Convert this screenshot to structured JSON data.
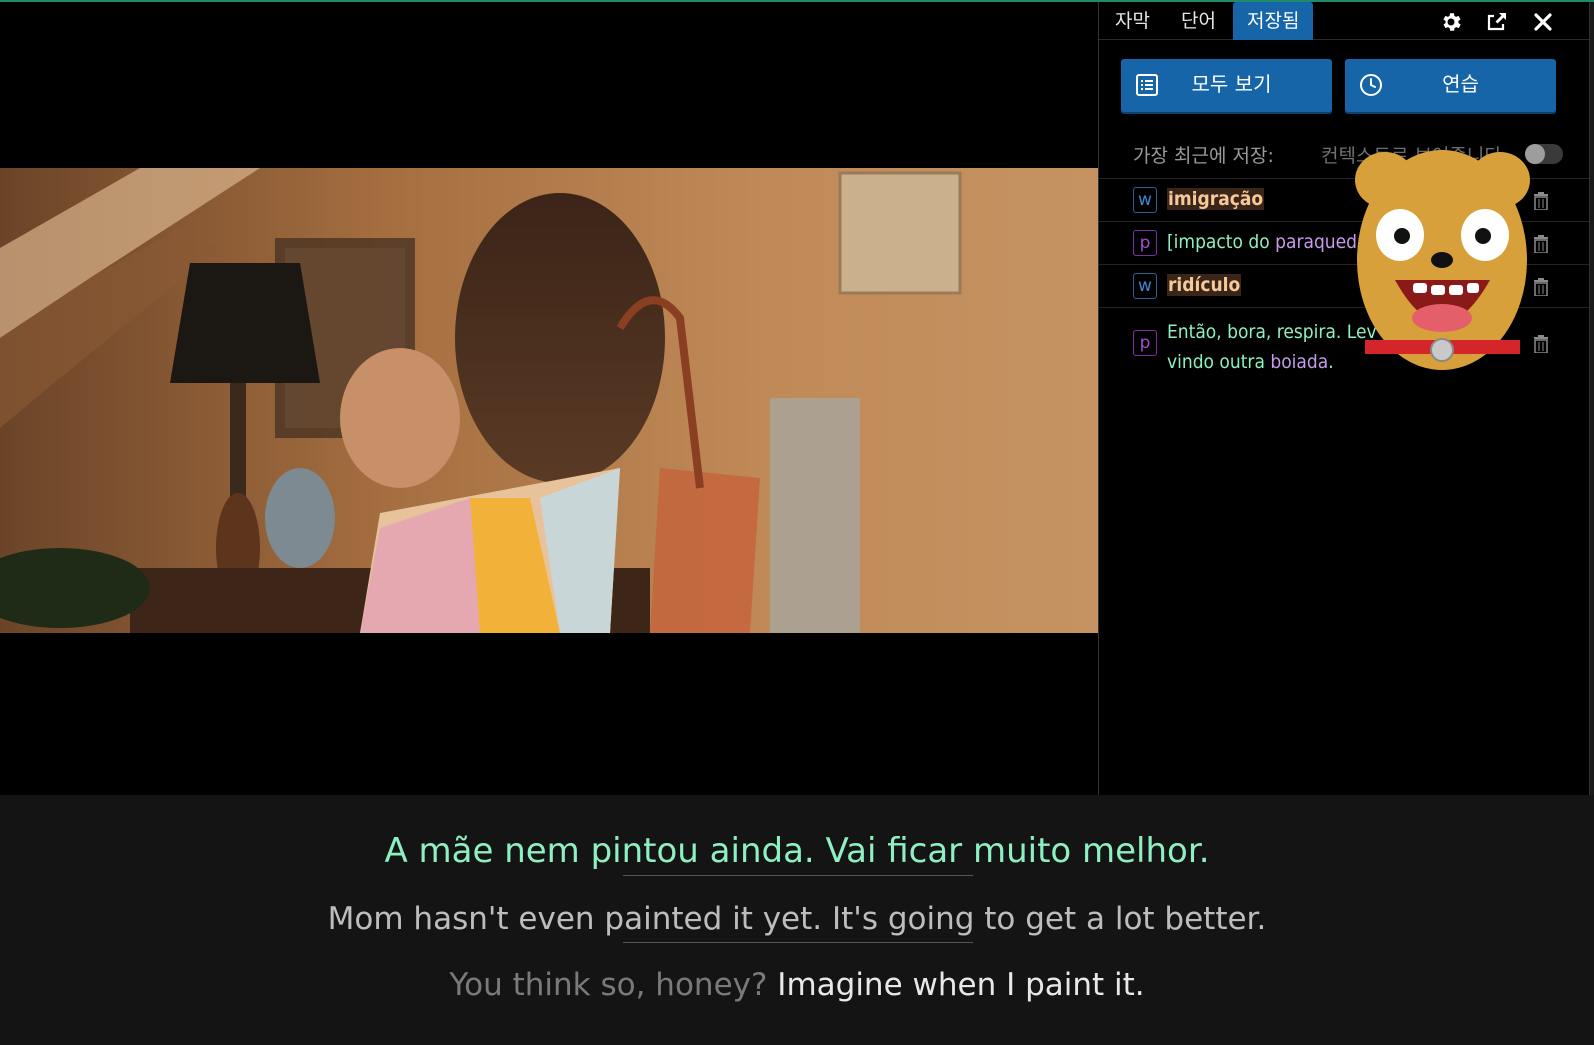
{
  "panel": {
    "tabs": [
      {
        "label": "자막",
        "active": false
      },
      {
        "label": "단어",
        "active": false
      },
      {
        "label": "저장됨",
        "active": true
      }
    ],
    "icons": [
      "gear-icon",
      "export-icon",
      "close-icon"
    ],
    "buttons": {
      "view_all": "모두 보기",
      "practice": "연습"
    },
    "recent_label": "가장 최근에 저장:",
    "context_label": "컨텍스트로 보여줍니다",
    "context_toggle_on": false,
    "saved_items": [
      {
        "type": "w",
        "text": "imigração"
      },
      {
        "type": "p",
        "text_parts": [
          "[impacto do ",
          "paraquedas"
        ]
      },
      {
        "type": "w",
        "text": "ridículo"
      },
      {
        "type": "p",
        "line1": "Então, bora, respira. Lev",
        "line2_parts": [
          "vindo outra ",
          "boiada",
          "."
        ]
      }
    ]
  },
  "subtitles": {
    "original": "A mãe nem pintou ainda. Vai ficar muito melhor.",
    "translation": "Mom hasn't even painted it yet. It's going to get a lot better.",
    "next_faded": "You think so, honey?",
    "next_bright": " Imagine when I paint it."
  },
  "colors": {
    "accent": "#1565a8",
    "subtitle_green": "#8ef0c1",
    "phrase_purple": "#c79bea",
    "word_highlight": "#f6c89a"
  }
}
